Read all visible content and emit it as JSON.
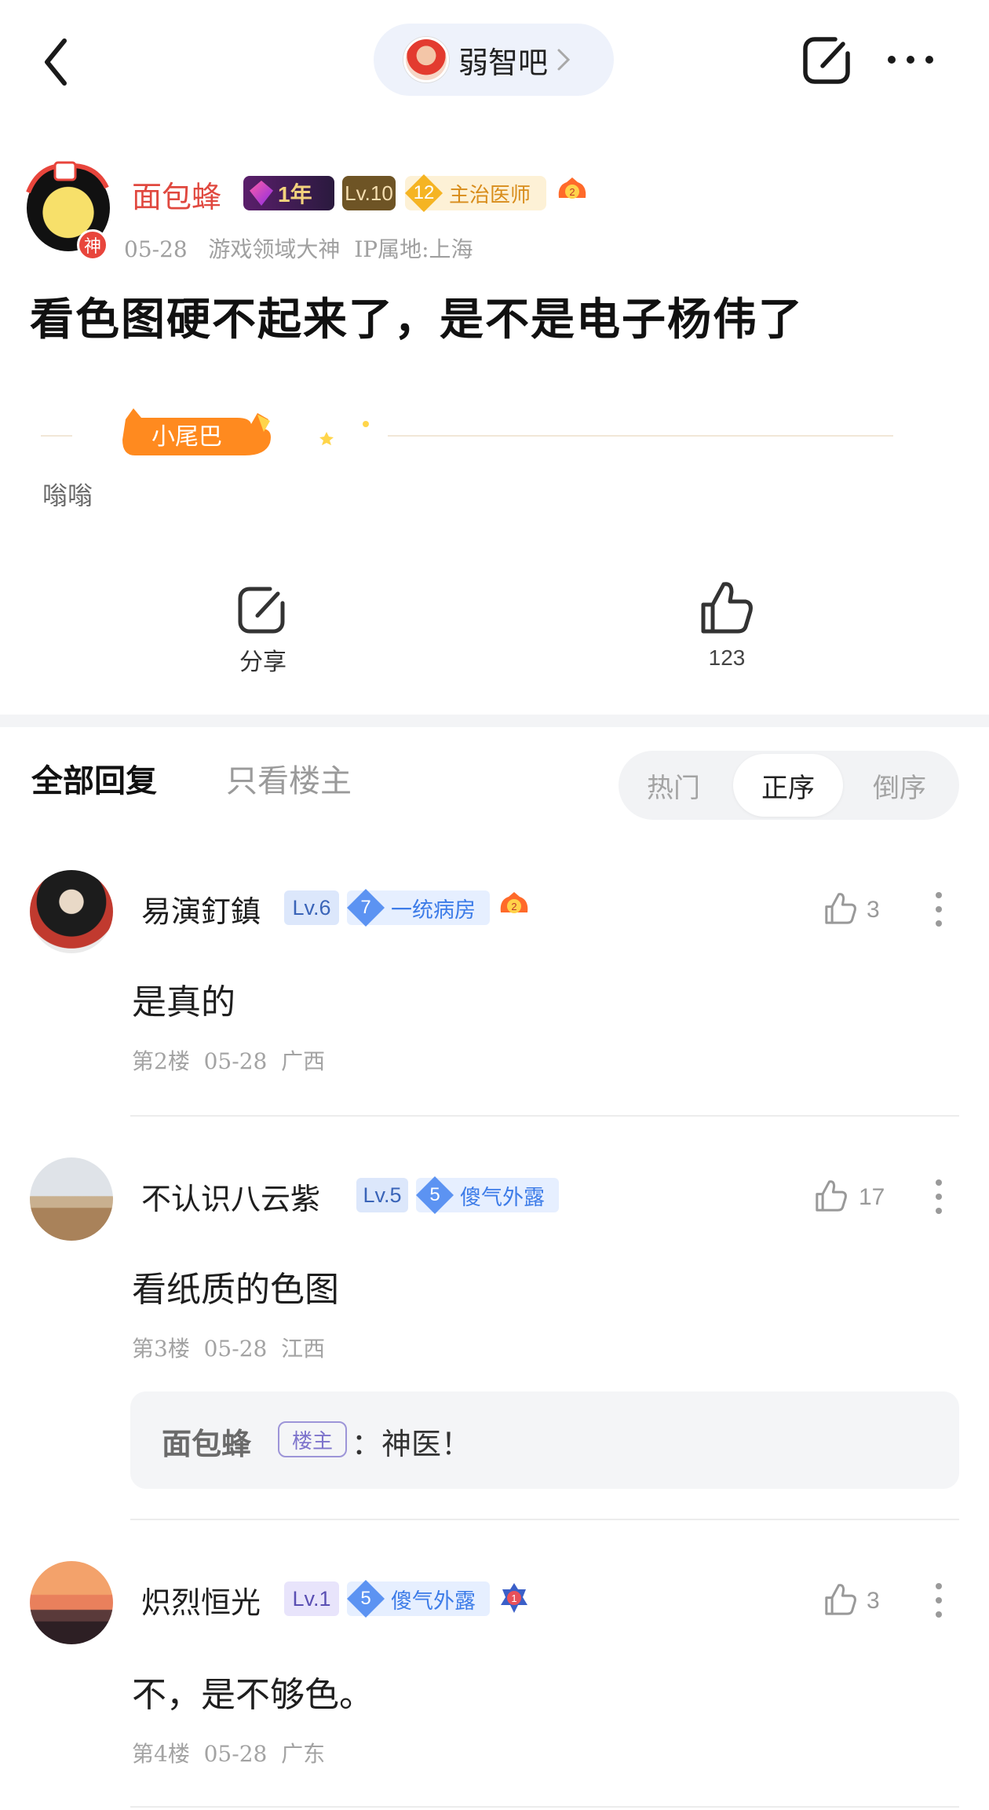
{
  "header": {
    "forum_name": "弱智吧"
  },
  "post": {
    "author": {
      "name": "面包蜂",
      "god_badge": "神",
      "year_badge": "1年",
      "level": "Lv.10",
      "title_num": "12",
      "title": "主治医师",
      "medal_num": "2",
      "meta": "05-28   游戏领域大神  IP属地:上海"
    },
    "title": "看色图硬不起来了，是不是电子杨伟了",
    "tail_label": "小尾巴",
    "tail_text": "嗡嗡",
    "share_label": "分享",
    "like_count": "123"
  },
  "tabs": {
    "all": "全部回复",
    "op_only": "只看楼主",
    "sort": [
      "热门",
      "正序",
      "倒序"
    ],
    "sort_selected": "正序"
  },
  "replies": [
    {
      "name": "易演釘鎮",
      "level": "Lv.6",
      "tag_num": "7",
      "tag": "一统病房",
      "medal_num": "2",
      "likes": "3",
      "body": "是真的",
      "meta": "第2楼  05-28  广西"
    },
    {
      "name": "不认识八云紫",
      "level": "Lv.5",
      "tag_num": "5",
      "tag": "傻气外露",
      "likes": "17",
      "body": "看纸质的色图",
      "meta": "第3楼  05-28  江西",
      "sub_reply": {
        "name": "面包蜂",
        "op_tag": "楼主",
        "text": "：神医！"
      }
    },
    {
      "name": "炽烈恒光",
      "level": "Lv.1",
      "tag_num": "5",
      "tag": "傻气外露",
      "medal_num": "1",
      "likes": "3",
      "body": "不，是不够色。",
      "meta": "第4楼  05-28  广东"
    }
  ],
  "colors": {
    "author_name": "#e0483f",
    "tail_orange": "#ff8a1f",
    "tag_blue": "#3d7ce8"
  }
}
